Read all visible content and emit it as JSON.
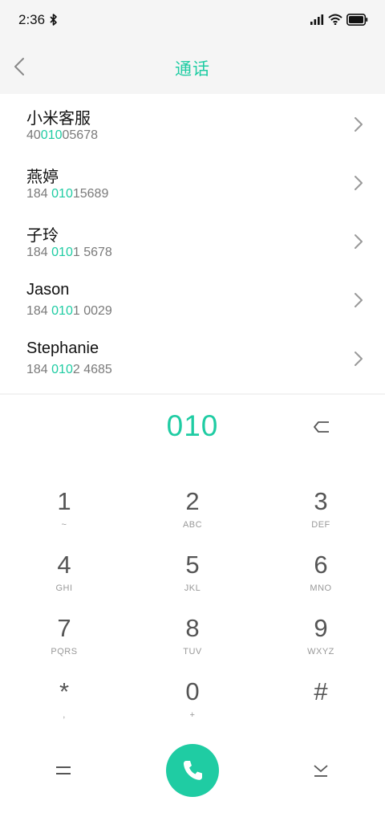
{
  "status_bar": {
    "time": "2:36",
    "icons": [
      "bluetooth-icon",
      "signal-icon",
      "wifi-icon",
      "battery-icon"
    ]
  },
  "header": {
    "title": "通话",
    "back_icon": "chevron-left-icon"
  },
  "contacts": [
    {
      "name": "小米客服",
      "num_pre": "40",
      "num_hl": "010",
      "num_post": "05678"
    },
    {
      "name": "燕婷",
      "num_pre": "184 ",
      "num_hl": "010",
      "num_post": "15689"
    },
    {
      "name": "子玲",
      "num_pre": "184 ",
      "num_hl": "010",
      "num_post": "1 5678"
    },
    {
      "name": "Jason",
      "num_pre": "184 ",
      "num_hl": "010",
      "num_post": "1 0029"
    },
    {
      "name": "Stephanie",
      "num_pre": "184 ",
      "num_hl": "010",
      "num_post": "2 4685"
    }
  ],
  "dialer": {
    "entered_number": "010",
    "keys": [
      {
        "digit": "1",
        "letters": "~"
      },
      {
        "digit": "2",
        "letters": "ABC"
      },
      {
        "digit": "3",
        "letters": "DEF"
      },
      {
        "digit": "4",
        "letters": "GHI"
      },
      {
        "digit": "5",
        "letters": "JKL"
      },
      {
        "digit": "6",
        "letters": "MNO"
      },
      {
        "digit": "7",
        "letters": "PQRS"
      },
      {
        "digit": "8",
        "letters": "TUV"
      },
      {
        "digit": "9",
        "letters": "WXYZ"
      },
      {
        "digit": "*",
        "letters": ","
      },
      {
        "digit": "0",
        "letters": "+"
      },
      {
        "digit": "#",
        "letters": ""
      }
    ]
  },
  "colors": {
    "accent": "#1fcca3",
    "header_bg": "#f5f5f5",
    "secondary_text": "#7a7a7a"
  }
}
